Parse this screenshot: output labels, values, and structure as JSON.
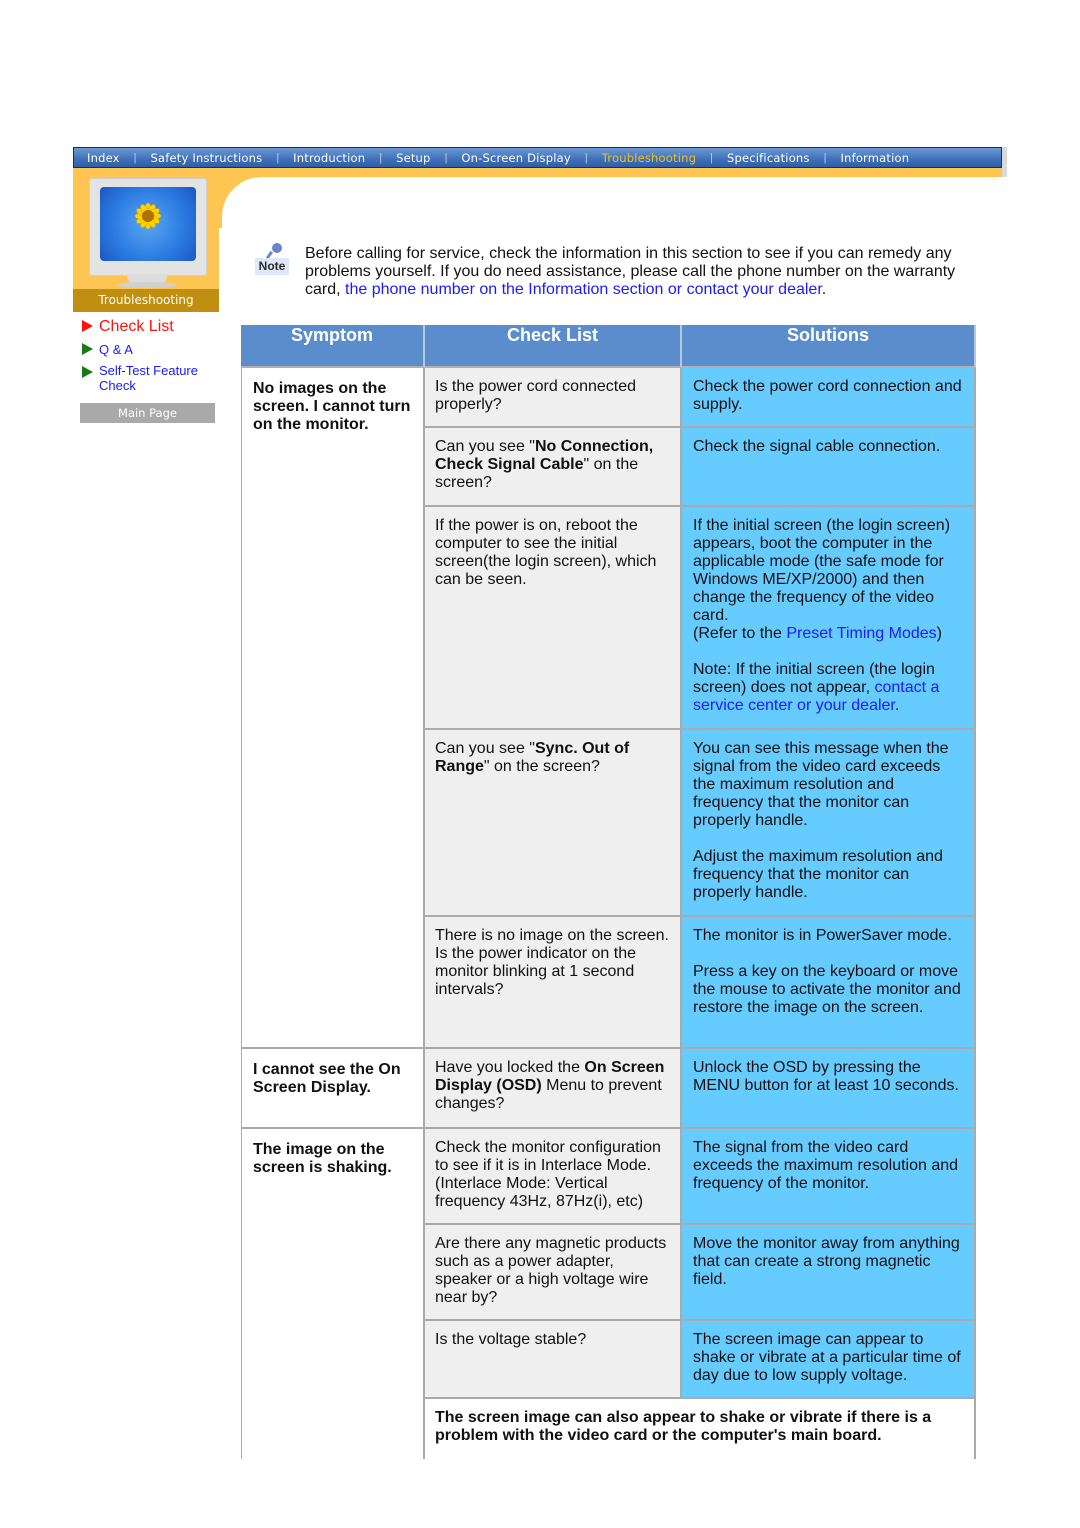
{
  "topnav": {
    "items": [
      {
        "label": "Index",
        "active": false
      },
      {
        "label": "Safety Instructions",
        "active": false
      },
      {
        "label": "Introduction",
        "active": false
      },
      {
        "label": "Setup",
        "active": false
      },
      {
        "label": "On-Screen Display",
        "active": false
      },
      {
        "label": "Troubleshooting",
        "active": true
      },
      {
        "label": "Specifications",
        "active": false
      },
      {
        "label": "Information",
        "active": false
      }
    ],
    "separator": "|"
  },
  "sidebar": {
    "section_label": "Troubleshooting",
    "links": [
      {
        "label": "Check List",
        "active": true,
        "icon": "red-triangle-bullet"
      },
      {
        "label": "Q & A",
        "active": false,
        "icon": "green-triangle-bullet"
      },
      {
        "label": "Self-Test Feature Check",
        "active": false,
        "icon": "green-triangle-bullet"
      }
    ],
    "main_page_button": "Main Page"
  },
  "note": {
    "icon_label": "Note",
    "text_before": "Before calling for service, check the information in this section to see if you can remedy any problems yourself. If you do need assistance, please call the phone number on the warranty card, ",
    "link_text": "the phone number on the Information section or contact your dealer",
    "text_after": "."
  },
  "table": {
    "headers": [
      "Symptom",
      "Check List",
      "Solutions"
    ],
    "groups": [
      {
        "symptom": "No images on the screen. I cannot turn on the monitor.",
        "rows": [
          {
            "check": [
              {
                "t": "Is the power cord connected properly?"
              }
            ],
            "solution": [
              {
                "t": "Check the power cord connection and supply."
              }
            ]
          },
          {
            "check": [
              {
                "t": "Can you see \""
              },
              {
                "t": "No Connection, Check Signal Cable",
                "b": true
              },
              {
                "t": "\" on the screen?"
              }
            ],
            "solution": [
              {
                "t": "Check the signal cable connection."
              }
            ]
          },
          {
            "check": [
              {
                "t": "If the power is on, reboot the computer to see the initial screen(the login screen), which can be seen."
              }
            ],
            "solution": [
              {
                "t": "If the initial screen (the login screen) appears, boot the computer in the applicable mode (the safe mode for Windows ME/XP/2000) and then change the frequency of the video card."
              },
              {
                "br": true
              },
              {
                "t": "(Refer to the "
              },
              {
                "t": "Preset Timing Modes",
                "link": true
              },
              {
                "t": ")"
              },
              {
                "gap": true
              },
              {
                "t": "Note: If the initial screen (the login screen) does not appear, "
              },
              {
                "t": "contact a service center or your dealer",
                "link": true
              },
              {
                "t": "."
              }
            ]
          },
          {
            "check": [
              {
                "t": "Can you see \""
              },
              {
                "t": "Sync. Out of Range",
                "b": true
              },
              {
                "t": "\" on the screen?"
              }
            ],
            "solution": [
              {
                "t": "You can see this message when the signal from the video card exceeds the maximum resolution and frequency that the monitor can properly handle."
              },
              {
                "gap": true
              },
              {
                "t": "Adjust the maximum resolution and frequency that the monitor can properly handle."
              }
            ]
          },
          {
            "check": [
              {
                "t": "There is no image on the screen. Is the power indicator on the monitor blinking at 1 second intervals?"
              }
            ],
            "solution": [
              {
                "t": "The monitor is in PowerSaver mode."
              },
              {
                "gap": true
              },
              {
                "t": "Press a key on the keyboard or move the mouse to activate the monitor and restore the image on the screen."
              }
            ]
          }
        ]
      },
      {
        "symptom": "I cannot see the On Screen Display.",
        "rows": [
          {
            "check": [
              {
                "t": "Have you locked the "
              },
              {
                "t": "On Screen Display (OSD)",
                "b": true
              },
              {
                "t": " Menu to prevent changes?"
              }
            ],
            "solution": [
              {
                "t": "Unlock the OSD by pressing the MENU button for at least 10 seconds."
              }
            ]
          }
        ]
      },
      {
        "symptom": "The image on the screen is shaking.",
        "rows": [
          {
            "check": [
              {
                "t": "Check the monitor configuration to see if it is in Interlace Mode. (Interlace Mode: Vertical frequency 43Hz, 87Hz(i), etc)"
              }
            ],
            "solution": [
              {
                "t": "The signal from the video card exceeds the maximum resolution and frequency of the monitor."
              }
            ]
          },
          {
            "check": [
              {
                "t": "Are there any magnetic products such as a power adapter, speaker or a high voltage wire near by?"
              }
            ],
            "solution": [
              {
                "t": "Move the monitor away from anything that can create a strong magnetic field."
              }
            ]
          },
          {
            "check": [
              {
                "t": "Is the voltage stable?"
              }
            ],
            "solution": [
              {
                "t": "The screen image can appear to shake or vibrate at a particular time of day due to low supply voltage."
              }
            ]
          }
        ],
        "footnote": "The screen image can also appear to shake or vibrate if there is a problem with the video card or the computer's main board."
      }
    ]
  },
  "colors": {
    "nav_blue": "#4a7cc4",
    "nav_active": "#f2c020",
    "orange": "#ffc552",
    "section_label_bg": "#c08e10",
    "header_blue": "#5b8ccb",
    "solution_blue": "#66ccff",
    "check_gray": "#efefef",
    "link_blue": "#1a1aff",
    "active_red": "#ff1010"
  }
}
